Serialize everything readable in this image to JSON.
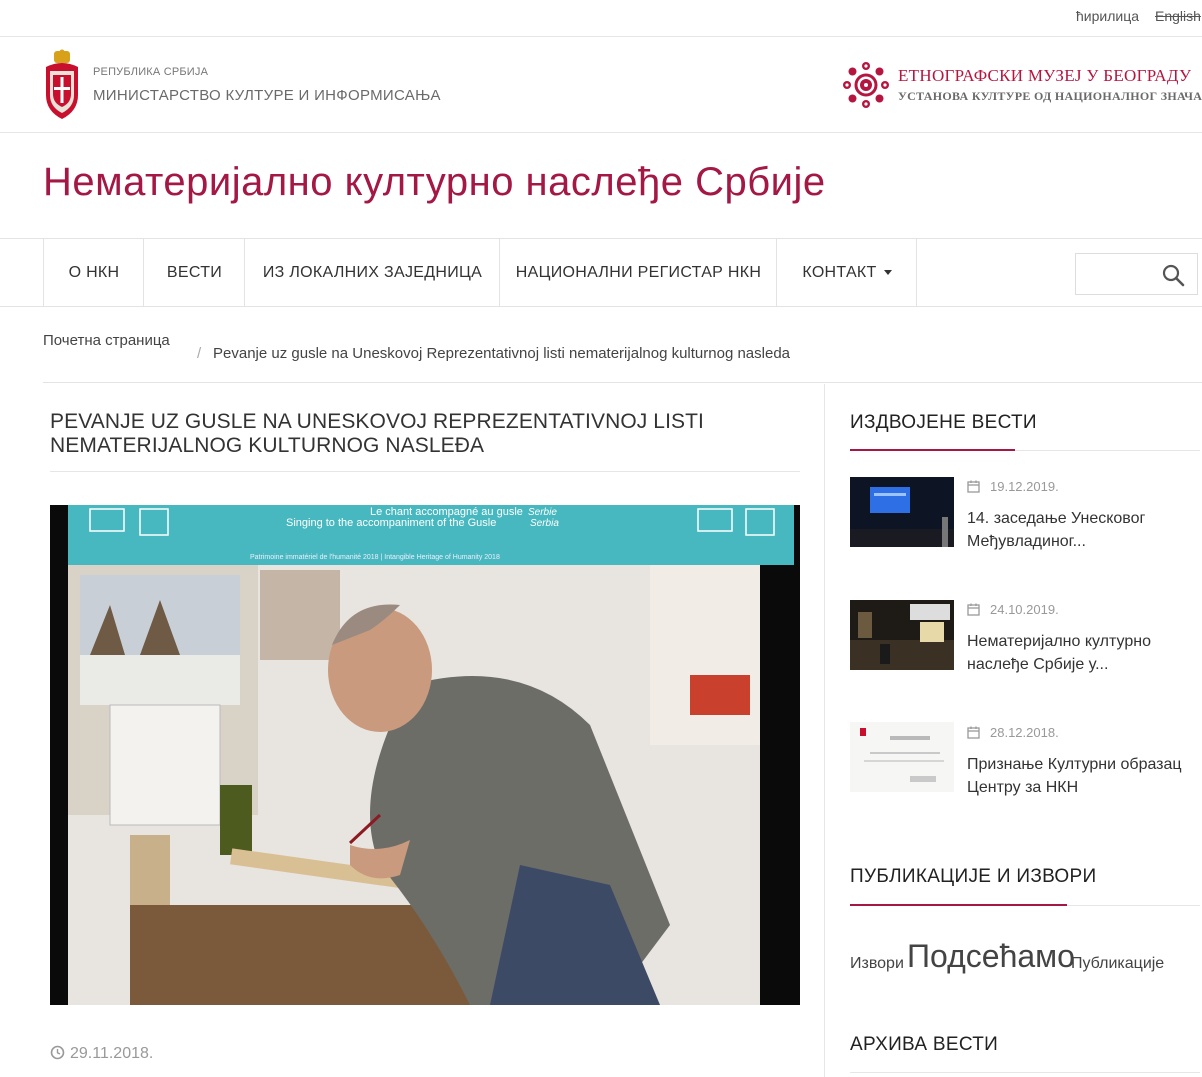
{
  "lang": {
    "cyrillic": "ћирилица",
    "english": "English"
  },
  "ministry": {
    "small": "РЕПУБЛИКА СРБИЈА",
    "big": "МИНИСТАРСТВО КУЛТУРЕ И ИНФОРМИСАЊА"
  },
  "museum": {
    "big": "ЕТНОГРАФСКИ МУЗЕЈ У БЕОГРАДУ",
    "small": "УСТАНОВА КУЛТУРЕ ОД НАЦИОНАЛНОГ ЗНАЧАЈА"
  },
  "site_title": "Нематеријално културно наслеђе Србије",
  "nav": {
    "items": [
      "О НКН",
      "ВЕСТИ",
      "ИЗ ЛОКАЛНИХ ЗАЈЕДНИЦА",
      "НАЦИОНАЛНИ РЕГИСТАР НКН"
    ],
    "contact": "КОНТАКТ",
    "search_value": ""
  },
  "breadcrumb": {
    "home": "Почетна страница",
    "separator": "/",
    "current": "Pevanje uz gusle na Uneskovoj Reprezentativnoj listi nematerijalnog kulturnog nasleda"
  },
  "article": {
    "title": "PEVANJE UZ GUSLE NA UNESKOVOJ REPREZENTATIVNOJ LISTI NEMATERIJALNOG KULTURNOG NASLEĐA",
    "date": "29.11.2018.",
    "banner": {
      "line1": "Le chant accompagné au gusle",
      "line1_country": "Serbie",
      "line2": "Singing to the accompaniment of the Gusle",
      "line2_country": "Serbia",
      "line3": "Patrimoine immatériel de l'humanité 2018 | Intangible Heritage of Humanity 2018"
    }
  },
  "sidebar": {
    "featured_heading": "ИЗДВОЈЕНЕ ВЕСТИ",
    "news": [
      {
        "date": "19.12.2019.",
        "title": "14. заседање Унесковог Међувладиног..."
      },
      {
        "date": "24.10.2019.",
        "title": "Нематеријално културно наслеђе Србије у..."
      },
      {
        "date": "28.12.2018.",
        "title": "Признање Културни образац Центру за НКН"
      }
    ],
    "publications_heading": "ПУБЛИКАЦИЈЕ И ИЗВОРИ",
    "tags": [
      "Извори",
      "Подсећамо",
      "Публикације"
    ],
    "archive_heading": "АРХИВА ВЕСТИ"
  },
  "colors": {
    "accent": "#a31844",
    "text": "#333333",
    "muted": "#999999"
  }
}
